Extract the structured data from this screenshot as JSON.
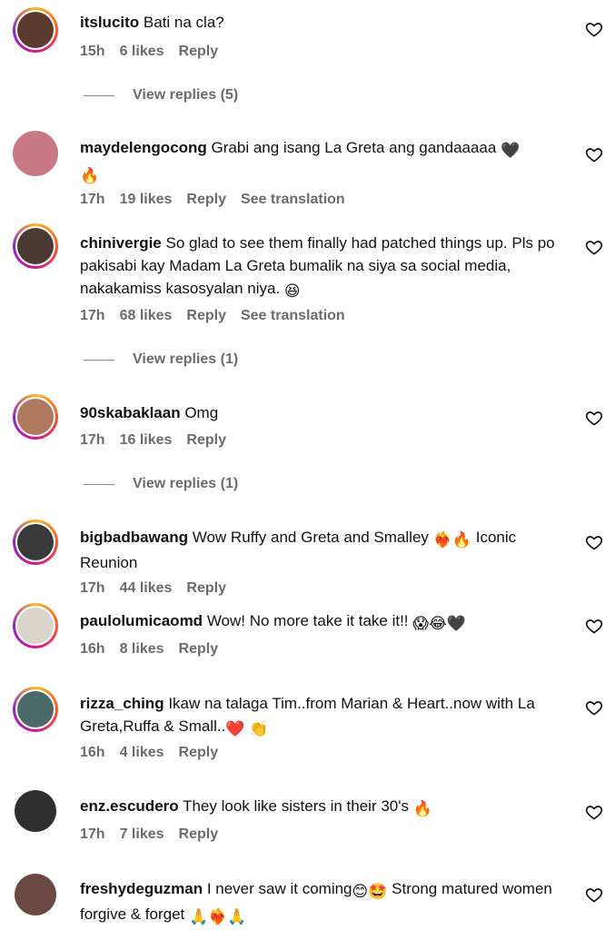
{
  "comments": [
    {
      "username": "itslucito",
      "text": "Bati na cla?",
      "time": "15h",
      "likes": "6 likes",
      "reply": "Reply",
      "avatar_color": "#5a3b2e",
      "story_ring": true
    },
    {
      "username": "maydelengocong",
      "text": "Grabi ang isang La Greta ang gandaaaaa",
      "emoji": [
        "black-heart",
        "fire"
      ],
      "time": "17h",
      "likes": "19 likes",
      "reply": "Reply",
      "translation": "See translation",
      "avatar_color": "#c77a86",
      "story_ring": false
    },
    {
      "username": "chinivergie",
      "text": "So glad to see them finally had patched things up. Pls po pakisabi kay Madam La Greta bumalik na siya sa social media, nakakamiss kasosyalan niya.",
      "emoji": [
        "grinning-squint-face"
      ],
      "time": "17h",
      "likes": "68 likes",
      "reply": "Reply",
      "translation": "See translation",
      "avatar_color": "#4a3a33",
      "story_ring": true
    },
    {
      "username": "90skabaklaan",
      "text": "Omg",
      "time": "17h",
      "likes": "16 likes",
      "reply": "Reply",
      "avatar_color": "#b07a60",
      "story_ring": true
    },
    {
      "username": "bigbadbawang",
      "text_before": "Wow Ruffy and Greta and Smalley",
      "emoji": [
        "heart-on-fire",
        "fire"
      ],
      "text_after": "Iconic Reunion",
      "time": "17h",
      "likes": "44 likes",
      "reply": "Reply",
      "avatar_color": "#3a3a3a",
      "story_ring": true
    },
    {
      "username": "paulolumicaomd",
      "text": "Wow! No more take it take it!!",
      "emoji": [
        "face-screaming",
        "laughing-tears",
        "black-heart"
      ],
      "time": "16h",
      "likes": "8 likes",
      "reply": "Reply",
      "avatar_color": "#d9d4cc",
      "story_ring": true
    },
    {
      "username": "rizza_ching",
      "text": "Ikaw na talaga Tim..from Marian & Heart..now with La Greta,Ruffa & Small..",
      "emoji": [
        "red-heart",
        "clapping-hands"
      ],
      "time": "16h",
      "likes": "4 likes",
      "reply": "Reply",
      "avatar_color": "#4c6a68",
      "story_ring": true
    },
    {
      "username": "enz.escudero",
      "text": "They look like sisters in their 30's",
      "emoji": [
        "fire"
      ],
      "time": "17h",
      "likes": "7 likes",
      "reply": "Reply",
      "avatar_color": "#2f2f2f",
      "story_ring": false
    },
    {
      "username": "freshydeguzman",
      "text_before": "I never saw it coming",
      "emoji_mid": [
        "smiling-face",
        "star-struck"
      ],
      "text_after": "Strong matured women forgive & forget",
      "emoji": [
        "folded-hands",
        "heart-on-fire",
        "folded-hands"
      ],
      "avatar_color": "#6b4a44",
      "story_ring": false
    }
  ],
  "view_replies": [
    "View replies (5)",
    "View replies (1)",
    "View replies (1)"
  ],
  "colors": {
    "meta": "#6b6b6b",
    "ring_start": "#f9b824",
    "ring_end": "#8a2ac2"
  }
}
